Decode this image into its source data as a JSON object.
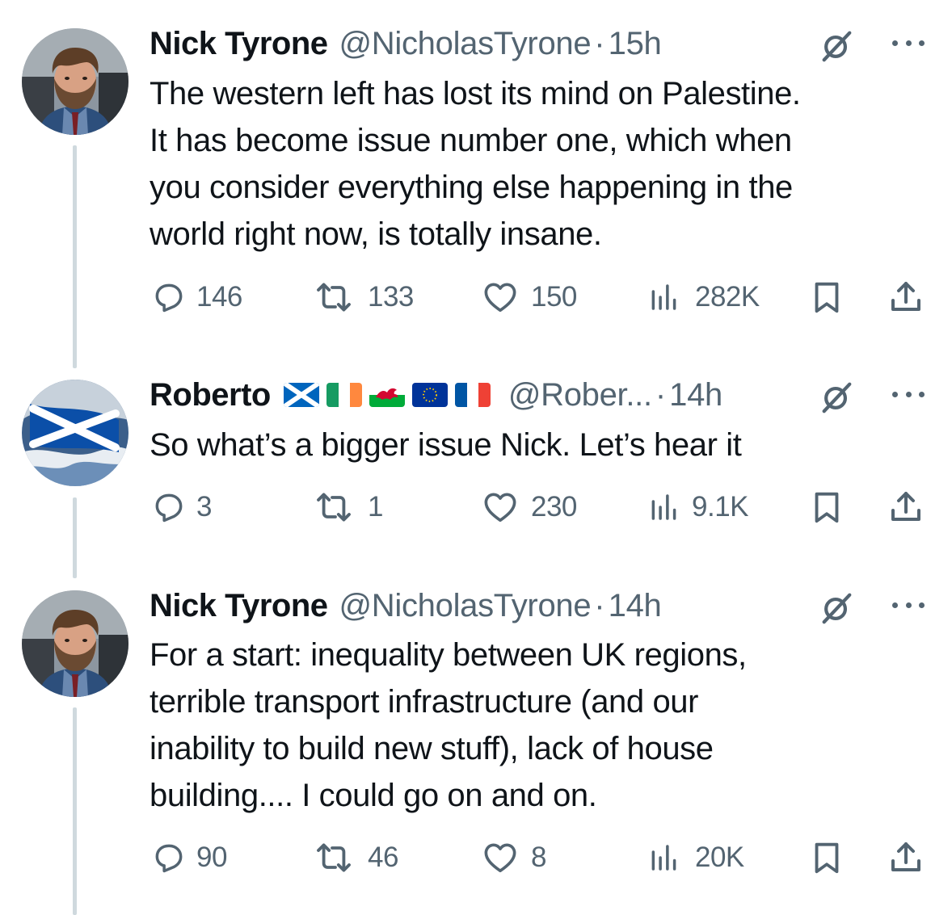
{
  "tweets": [
    {
      "name": "Nick Tyrone",
      "handle": "@NicholasTyrone",
      "separator": "·",
      "time": "15h",
      "text": "The western left has lost its mind on Palestine.\nIt has become issue number one, which when\nyou consider everything else happening in the\nworld right now, is totally insane.",
      "replies": "146",
      "retweets": "133",
      "likes": "150",
      "views": "282K"
    },
    {
      "name": "Roberto",
      "flags": [
        "scotland-flag",
        "ireland-flag",
        "wales-flag",
        "eu-flag",
        "france-flag"
      ],
      "handle": "@Rober...",
      "separator": "·",
      "time": "14h",
      "text": "So what’s a bigger issue Nick.  Let’s hear it",
      "replies": "3",
      "retweets": "1",
      "likes": "230",
      "views": "9.1K"
    },
    {
      "name": "Nick Tyrone",
      "handle": "@NicholasTyrone",
      "separator": "·",
      "time": "14h",
      "text": "For a start: inequality between UK regions,\nterrible transport infrastructure (and our\ninability to build new stuff), lack of house\nbuilding.... I could go on and on.",
      "replies": "90",
      "retweets": "46",
      "likes": "8",
      "views": "20K"
    }
  ],
  "colors": {
    "text": "#0f1419",
    "secondary": "#536471",
    "thread_line": "#cfd9de"
  },
  "icons": [
    "reply-icon",
    "retweet-icon",
    "like-icon",
    "views-icon",
    "bookmark-icon",
    "share-icon",
    "grok-icon",
    "more-icon"
  ]
}
